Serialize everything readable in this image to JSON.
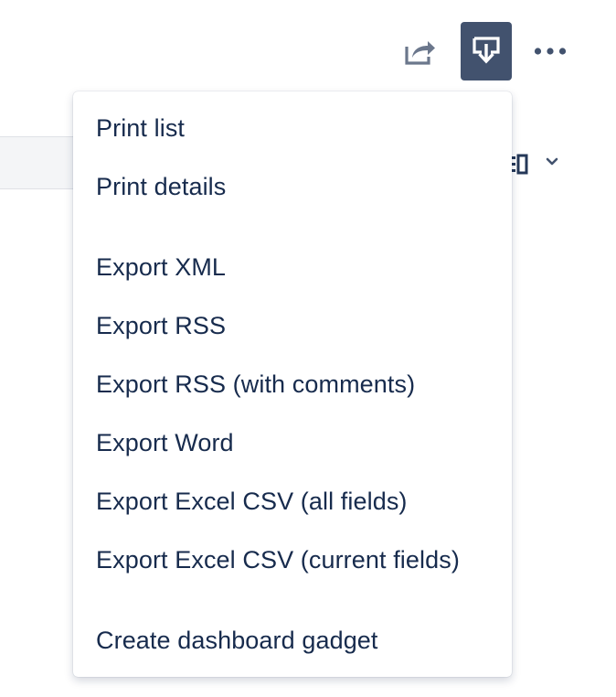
{
  "toolbar": {
    "share_icon": "share-icon",
    "export_icon": "export-icon",
    "more_icon": "more-icon"
  },
  "layout_switcher": {
    "icon": "list-view-icon",
    "chevron": "chevron-down-icon"
  },
  "export_menu": {
    "groups": [
      {
        "items": [
          {
            "label": "Print list"
          },
          {
            "label": "Print details"
          }
        ]
      },
      {
        "items": [
          {
            "label": "Export XML"
          },
          {
            "label": "Export RSS"
          },
          {
            "label": "Export RSS (with comments)"
          },
          {
            "label": "Export Word"
          },
          {
            "label": "Export Excel CSV (all fields)"
          },
          {
            "label": "Export Excel CSV (current fields)"
          }
        ]
      },
      {
        "items": [
          {
            "label": "Create dashboard gadget"
          }
        ]
      }
    ]
  },
  "colors": {
    "text": "#172b4d",
    "icon_muted": "#6b778c",
    "button_selected_bg": "#42526e",
    "button_selected_fg": "#ffffff",
    "menu_bg": "#ffffff"
  }
}
